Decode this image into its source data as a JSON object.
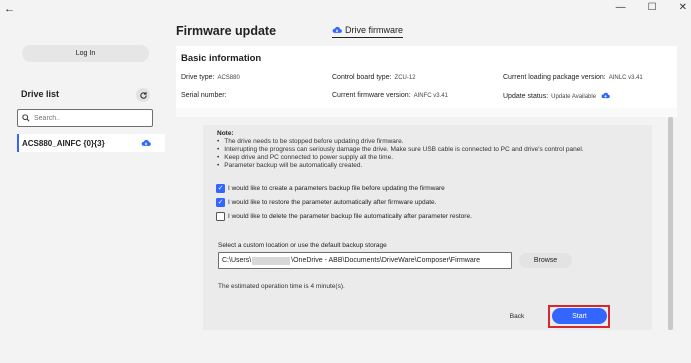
{
  "window": {
    "back_glyph": "←",
    "minimize_glyph": "—",
    "maximize_glyph": "☐",
    "close_glyph": "✕"
  },
  "sidebar": {
    "login_label": "Log In",
    "drive_list_title": "Drive list",
    "search_placeholder": "Search..",
    "drives": [
      {
        "name": "ACS880_AINFC {0}{3}",
        "status_icon": "cloud-icon"
      }
    ]
  },
  "main": {
    "title": "Firmware update",
    "tab_label": "Drive firmware",
    "info": {
      "title": "Basic information",
      "drive_type_label": "Drive type:",
      "drive_type_value": "ACS880",
      "control_board_label": "Control board type:",
      "control_board_value": "ZCU-12",
      "loading_package_label": "Current loading package version:",
      "loading_package_value": "AINLC v3.41",
      "serial_label": "Serial number:",
      "serial_value": "",
      "firmware_version_label": "Current firmware version:",
      "firmware_version_value": "AINFC v3.41",
      "update_status_label": "Update status:",
      "update_status_value": "Update Available"
    },
    "note": {
      "title": "Note:",
      "items": [
        "The drive needs to be stopped before updating drive firmware.",
        "Interrupting the progress can seriously damage the drive. Make sure USB cable is connected to PC and drive's control panel.",
        "Keep drive and PC connected to power supply all the time.",
        "Parameter backup will be automatically created."
      ]
    },
    "options": [
      {
        "label": "I would like to create a parameters backup file before updating the firmware",
        "checked": true
      },
      {
        "label": "I would like to restore the parameter automatically after firmware update.",
        "checked": true
      },
      {
        "label": "I would like to delete the parameter backup file automatically after parameter restore.",
        "checked": false
      }
    ],
    "storage_label": "Select a custom location or use the default backup storage",
    "path_prefix": "C:\\Users\\",
    "path_suffix": "\\OneDrive - ABB\\Documents\\DriveWare\\Composer\\Firmware",
    "browse_label": "Browse",
    "estimate_text": "The estimated operation time is 4 minute(s).",
    "back_label": "Back",
    "start_label": "Start"
  },
  "colors": {
    "accent": "#3366ff",
    "highlight": "#d6282f",
    "background": "#f3f3f3"
  }
}
